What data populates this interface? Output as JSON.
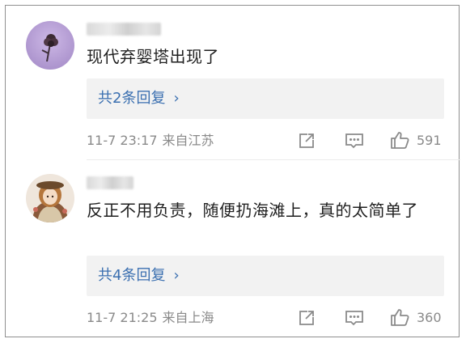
{
  "comments": [
    {
      "text": "现代弃婴塔出现了",
      "replies_label": "共2条回复",
      "time": "11-7 23:17",
      "location": "来自江苏",
      "likes": "591"
    },
    {
      "text": "反正不用负责，随便扔海滩上，真的太简单了",
      "replies_label": "共4条回复",
      "time": "11-7 21:25",
      "location": "来自上海",
      "likes": "360"
    }
  ],
  "icons": {
    "share": "share-icon",
    "comment": "comment-icon",
    "like": "thumbs-up-icon",
    "chevron": "chevron-right-icon"
  },
  "colors": {
    "link": "#3a6fb0",
    "meta": "#8a8a8a",
    "reply_bg": "#f2f2f2"
  }
}
